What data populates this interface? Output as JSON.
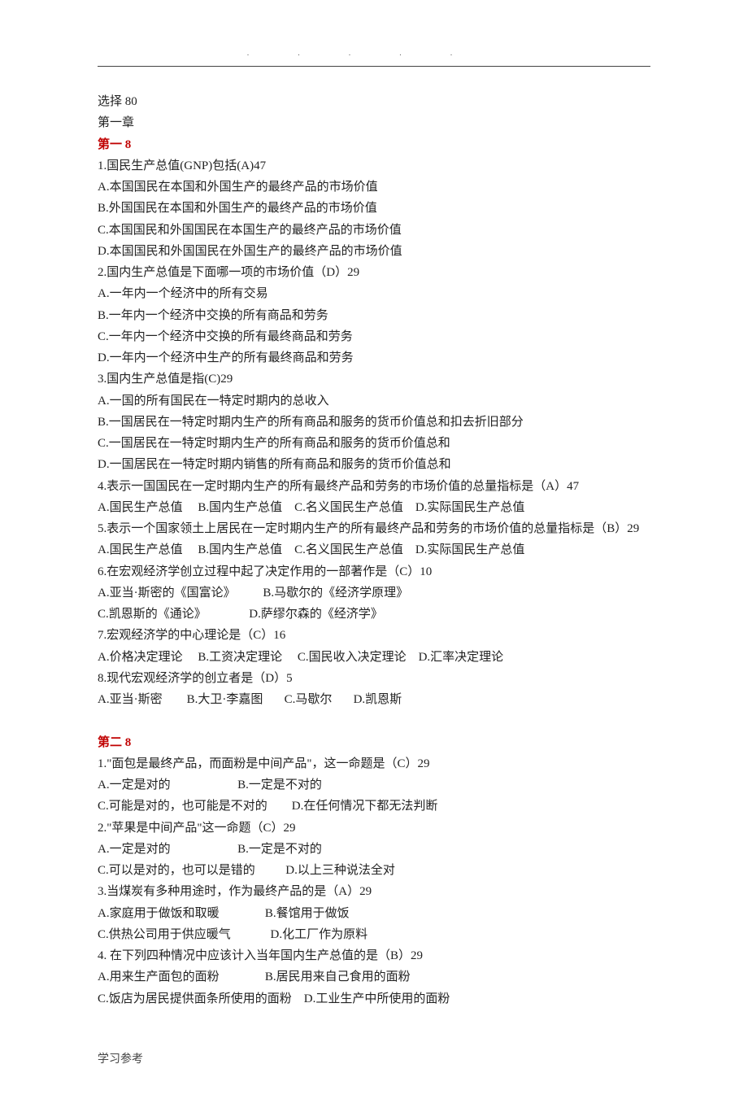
{
  "dots": ".....",
  "intro": {
    "select": "选择 80",
    "chapter": "第一章"
  },
  "section1": {
    "header": "第一 8",
    "q1": {
      "stem": "1.国民生产总值(GNP)包括(A)47",
      "a": "A.本国国民在本国和外国生产的最终产品的市场价值",
      "b": "B.外国国民在本国和外国生产的最终产品的市场价值",
      "c": "C.本国国民和外国国民在本国生产的最终产品的市场价值",
      "d": "D.本国国民和外国国民在外国生产的最终产品的市场价值"
    },
    "q2": {
      "stem": "2.国内生产总值是下面哪一项的市场价值（D）29",
      "a": "A.一年内一个经济中的所有交易",
      "b": "B.一年内一个经济中交换的所有商品和劳务",
      "c": "C.一年内一个经济中交换的所有最终商品和劳务",
      "d": "D.一年内一个经济中生产的所有最终商品和劳务"
    },
    "q3": {
      "stem": "3.国内生产总值是指(C)29",
      "a": "A.一国的所有国民在一特定时期内的总收入",
      "b": "B.一国居民在一特定时期内生产的所有商品和服务的货币价值总和扣去折旧部分",
      "c": "C.一国居民在一特定时期内生产的所有商品和服务的货币价值总和",
      "d": "D.一国居民在一特定时期内销售的所有商品和服务的货币价值总和"
    },
    "q4": {
      "stem": "4.表示一国国民在一定时期内生产的所有最终产品和劳务的市场价值的总量指标是（A）47",
      "opts": "A.国民生产总值     B.国内生产总值    C.名义国民生产总值    D.实际国民生产总值"
    },
    "q5": {
      "stem": "5.表示一个国家领土上居民在一定时期内生产的所有最终产品和劳务的市场价值的总量指标是（B）29",
      "opts": "A.国民生产总值     B.国内生产总值    C.名义国民生产总值    D.实际国民生产总值"
    },
    "q6": {
      "stem": "6.在宏观经济学创立过程中起了决定作用的一部著作是（C）10",
      "row1": "A.亚当·斯密的《国富论》         B.马歇尔的《经济学原理》",
      "row2": "C.凯恩斯的《通论》              D.萨缪尔森的《经济学》"
    },
    "q7": {
      "stem": "7.宏观经济学的中心理论是（C）16",
      "opts": "A.价格决定理论     B.工资决定理论     C.国民收入决定理论    D.汇率决定理论"
    },
    "q8": {
      "stem": "8.现代宏观经济学的创立者是（D）5",
      "opts": "A.亚当·斯密        B.大卫·李嘉图       C.马歇尔       D.凯恩斯"
    }
  },
  "section2": {
    "header": "第二 8",
    "q1": {
      "stem": "1.\"面包是最终产品，而面粉是中间产品\"，这一命题是（C）29",
      "row1": "A.一定是对的                      B.一定是不对的",
      "row2": "C.可能是对的，也可能是不对的        D.在任何情况下都无法判断"
    },
    "q2": {
      "stem": "2.\"苹果是中间产品\"这一命题（C）29",
      "row1": "A.一定是对的                      B.一定是不对的",
      "row2": "C.可以是对的，也可以是错的          D.以上三种说法全对"
    },
    "q3": {
      "stem": "3.当煤炭有多种用途时，作为最终产品的是（A）29",
      "row1": "A.家庭用于做饭和取暖               B.餐馆用于做饭",
      "row2": "C.供热公司用于供应暖气             D.化工厂作为原料"
    },
    "q4": {
      "stem": "4. 在下列四种情况中应该计入当年国内生产总值的是（B）29",
      "row1": "A.用来生产面包的面粉               B.居民用来自己食用的面粉",
      "row2": "C.饭店为居民提供面条所使用的面粉    D.工业生产中所使用的面粉"
    }
  },
  "footer": "学习参考"
}
